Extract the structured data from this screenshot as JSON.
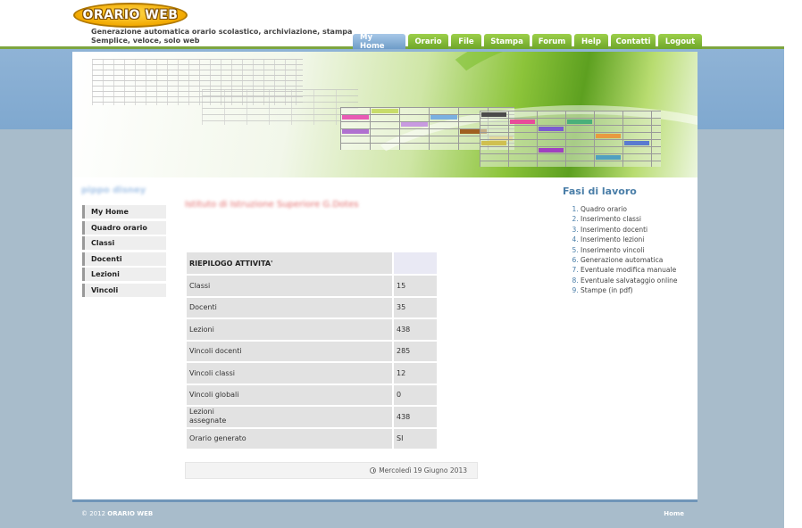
{
  "brand": {
    "logo_text": "ORARIO WEB",
    "tagline_1": "Generazione automatica orario scolastico, archiviazione, stampa",
    "tagline_2": "Semplice, veloce, solo web"
  },
  "nav": {
    "tabs": [
      {
        "label": "My Home",
        "active": true
      },
      {
        "label": "Orario"
      },
      {
        "label": "File"
      },
      {
        "label": "Stampa"
      },
      {
        "label": "Forum"
      },
      {
        "label": "Help"
      },
      {
        "label": "Contatti"
      },
      {
        "label": "Logout"
      }
    ]
  },
  "sidebar": {
    "user": "pippo disney",
    "items": [
      {
        "label": "My Home"
      },
      {
        "label": "Quadro orario"
      },
      {
        "label": "Classi"
      },
      {
        "label": "Docenti"
      },
      {
        "label": "Lezioni"
      },
      {
        "label": "Vincoli"
      }
    ]
  },
  "main": {
    "school": "Istituto di Istruzione Superiore G.Dotes",
    "summary": {
      "header": "RIEPILOGO ATTIVITA'",
      "rows": [
        {
          "label": "Classi",
          "value": "15"
        },
        {
          "label": "Docenti",
          "value": "35"
        },
        {
          "label": "Lezioni",
          "value": "438"
        },
        {
          "label": "Vincoli docenti",
          "value": "285"
        },
        {
          "label": "Vincoli classi",
          "value": "12"
        },
        {
          "label": "Vincoli globali",
          "value": "0"
        },
        {
          "label": "Lezioni assegnate",
          "value": "438"
        },
        {
          "label": "Orario generato",
          "value": "SI"
        }
      ]
    },
    "date": "Mercoledì 19 Giugno 2013"
  },
  "fasi": {
    "title": "Fasi di lavoro",
    "items": [
      "Quadro orario",
      "Inserimento classi",
      "Inserimento docenti",
      "Inserimento lezioni",
      "Inserimento vincoli",
      "Generazione automatica",
      "Eventuale modifica manuale",
      "Eventuale salvataggio online",
      "Stampe (in pdf)"
    ]
  },
  "footer": {
    "year": "© 2012",
    "brand": "ORARIO WEB",
    "home": "Home"
  },
  "colors": {
    "accent_green": "#7da53f",
    "active_tab_blue": "#6e9cc8",
    "fasi_title": "#4a7ea8"
  }
}
